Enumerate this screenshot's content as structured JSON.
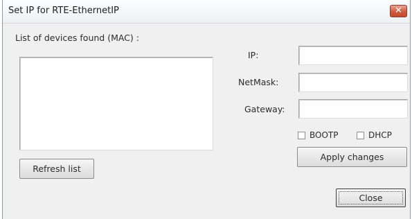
{
  "window": {
    "title": "Set IP for RTE-EthernetIP",
    "close_glyph": "✕"
  },
  "devices": {
    "label": "List of devices found (MAC) :",
    "items": []
  },
  "fields": {
    "ip_label": "IP:",
    "ip_value": "",
    "netmask_label": "NetMask:",
    "netmask_value": "",
    "gateway_label": "Gateway:",
    "gateway_value": ""
  },
  "options": {
    "bootp_label": "BOOTP",
    "bootp_checked": false,
    "dhcp_label": "DHCP",
    "dhcp_checked": false
  },
  "buttons": {
    "refresh": "Refresh list",
    "apply": "Apply changes",
    "close": "Close"
  },
  "colors": {
    "close_button": "#cf5a40",
    "dialog_background": "#f0f0f0"
  }
}
